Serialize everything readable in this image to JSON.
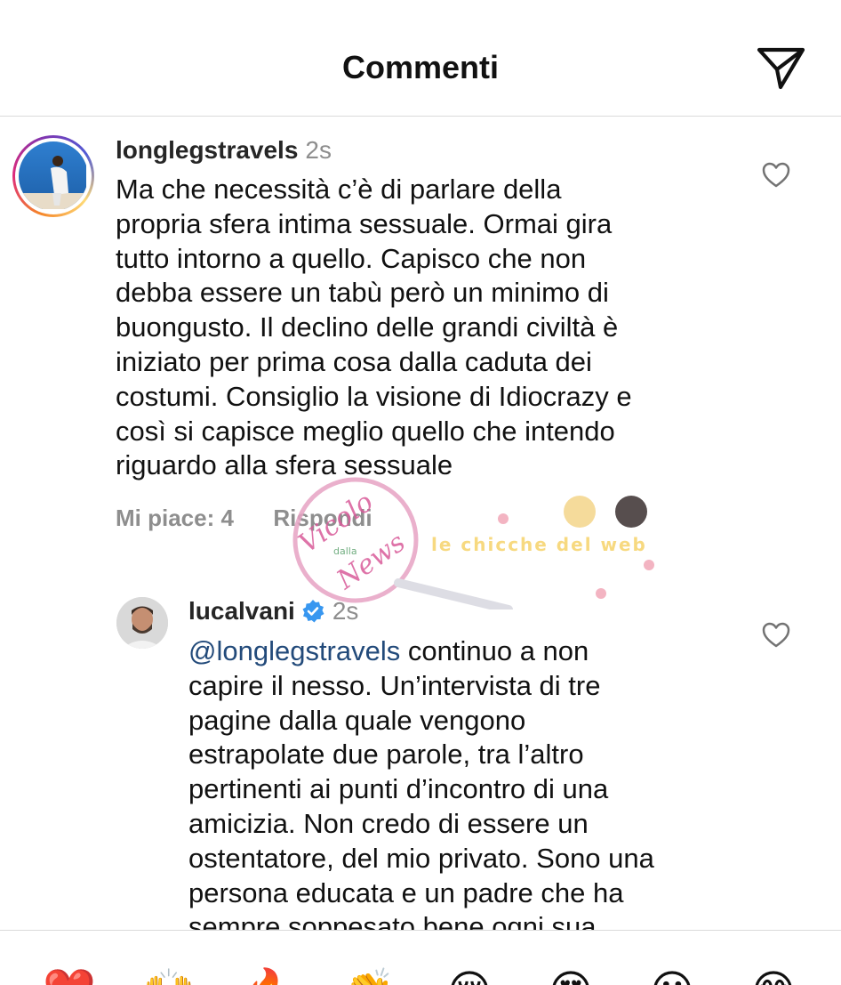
{
  "header": {
    "title": "Commenti",
    "share_icon": "paper-plane-icon"
  },
  "comments": [
    {
      "username": "longlegstravels",
      "time": "2s",
      "lines": [
        "Ma che necessità c’è di parlare della",
        "propria sfera intima sessuale. Ormai gira",
        "tutto intorno a quello. Capisco che non",
        "debba essere un tabù però un minimo di",
        "buongusto. Il declino delle grandi civiltà è",
        "iniziato per prima cosa dalla caduta dei",
        "costumi. Consiglio la visione di Idiocrazy e",
        "così si capisce meglio quello che intendo",
        "riguardo alla sfera sessuale"
      ],
      "likes": "Mi piace: 4",
      "reply": "Rispondi"
    },
    {
      "username": "lucalvani",
      "verified": true,
      "time": "2s",
      "mention": "@longlegstravels",
      "first_line_rest": " continuo a non",
      "lines": [
        "capire il nesso. Un’intervista di tre",
        "pagine dalla quale vengono",
        "estrapolate due parole, tra l’altro",
        "pertinenti ai punti d’incontro di una",
        "amicizia. Non credo di essere un",
        "ostentatore, del mio privato. Sono una",
        "persona educata e un padre che ha",
        "sempre soppesato bene ogni sua"
      ]
    }
  ],
  "watermark": {
    "text": "Vicolo delle News",
    "sub": "dalla",
    "tagline": "le chicche del web"
  },
  "reactions": [
    "❤️",
    "🙌",
    "🔥",
    "👏",
    "😢",
    "😍",
    "😮",
    "😂"
  ],
  "colors": {
    "mention": "#224a7a",
    "secondary": "#8e8e8e",
    "verified": "#3897f0"
  }
}
